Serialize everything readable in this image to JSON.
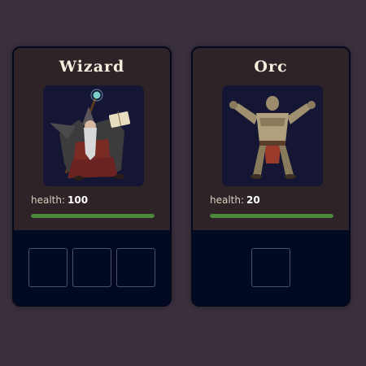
{
  "cards": [
    {
      "name": "Wizard",
      "portrait_icon": "wizard-portrait-icon",
      "health_label": "health:",
      "health_value": "100",
      "health_fraction": 1.0,
      "slot_count": 3
    },
    {
      "name": "Orc",
      "portrait_icon": "orc-portrait-icon",
      "health_label": "health:",
      "health_value": "20",
      "health_fraction": 1.0,
      "slot_count": 1
    }
  ],
  "colors": {
    "background": "#3a2f3d",
    "card_top": "#2e2326",
    "card_bottom": "#020a22",
    "health_bar": "#4b8a3a"
  }
}
